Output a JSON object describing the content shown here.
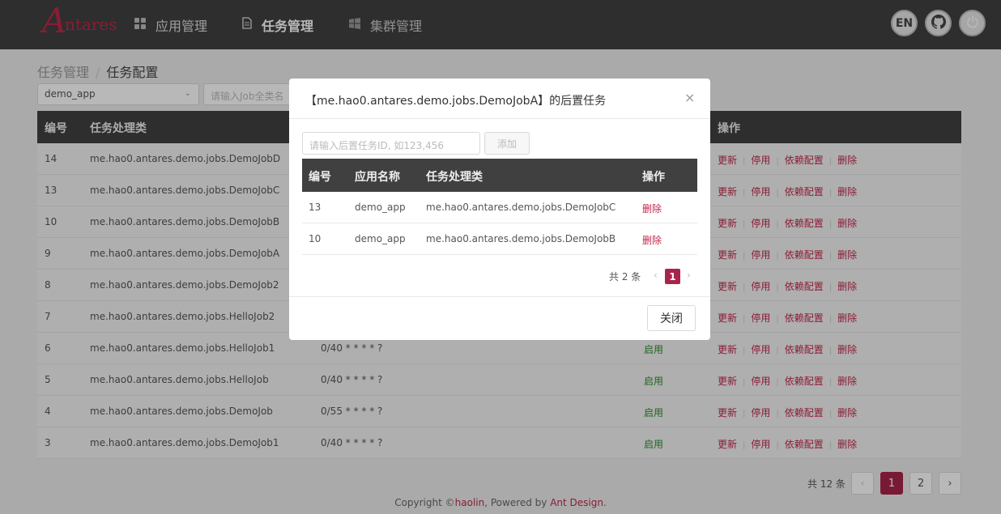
{
  "header": {
    "logo_text": "Antares",
    "nav": [
      {
        "label": "应用管理",
        "icon": "grid-icon"
      },
      {
        "label": "任务管理",
        "icon": "document-icon"
      },
      {
        "label": "集群管理",
        "icon": "windows-icon"
      }
    ],
    "lang_label": "EN",
    "github_icon": "github-icon",
    "power_icon": "power-icon"
  },
  "breadcrumb": {
    "parent": "任务管理",
    "separator": "/",
    "current": "任务配置"
  },
  "filters": {
    "app_select_value": "demo_app",
    "job_search_placeholder": "请输入Job全类名"
  },
  "table": {
    "columns": [
      "编号",
      "任务处理类",
      "操作"
    ],
    "rows": [
      {
        "id": "14",
        "cls": "me.hao0.antares.demo.jobs.DemoJobD",
        "cron": "",
        "status": ""
      },
      {
        "id": "13",
        "cls": "me.hao0.antares.demo.jobs.DemoJobC",
        "cron": "",
        "status": ""
      },
      {
        "id": "10",
        "cls": "me.hao0.antares.demo.jobs.DemoJobB",
        "cron": "",
        "status": ""
      },
      {
        "id": "9",
        "cls": "me.hao0.antares.demo.jobs.DemoJobA",
        "cron": "",
        "status": ""
      },
      {
        "id": "8",
        "cls": "me.hao0.antares.demo.jobs.DemoJob2",
        "cron": "",
        "status": ""
      },
      {
        "id": "7",
        "cls": "me.hao0.antares.demo.jobs.HelloJob2",
        "cron": "",
        "status": ""
      },
      {
        "id": "6",
        "cls": "me.hao0.antares.demo.jobs.HelloJob1",
        "cron": "0/40 * * * * ?",
        "status": "启用"
      },
      {
        "id": "5",
        "cls": "me.hao0.antares.demo.jobs.HelloJob",
        "cron": "0/40 * * * * ?",
        "status": "启用"
      },
      {
        "id": "4",
        "cls": "me.hao0.antares.demo.jobs.DemoJob",
        "cron": "0/55 * * * * ?",
        "status": "启用"
      },
      {
        "id": "3",
        "cls": "me.hao0.antares.demo.jobs.DemoJob1",
        "cron": "0/40 * * * * ?",
        "status": "启用"
      }
    ],
    "actions": [
      "更新",
      "停用",
      "依赖配置",
      "删除"
    ]
  },
  "pagination": {
    "total_text": "共 12 条",
    "pages": [
      "1",
      "2"
    ],
    "current": "1",
    "prev": "‹",
    "next": "›"
  },
  "footer": {
    "prefix": "Copyright  ©",
    "author": "haolin",
    "middle": ", Powered by ",
    "powered": "Ant Design",
    "suffix": "."
  },
  "modal": {
    "title": "【me.hao0.antares.demo.jobs.DemoJobA】的后置任务",
    "close_icon": "×",
    "input_placeholder": "请输入后置任务ID, 如123,456",
    "add_label": "添加",
    "columns": [
      "编号",
      "应用名称",
      "任务处理类",
      "操作"
    ],
    "rows": [
      {
        "id": "13",
        "app": "demo_app",
        "cls": "me.hao0.antares.demo.jobs.DemoJobC",
        "action": "删除"
      },
      {
        "id": "10",
        "app": "demo_app",
        "cls": "me.hao0.antares.demo.jobs.DemoJobB",
        "action": "删除"
      }
    ],
    "total_text": "共 2 条",
    "page": "1",
    "prev": "‹",
    "next": "›",
    "close_label": "关闭"
  },
  "colors": {
    "accent": "#a8244a",
    "header_bg": "#404040",
    "enabled": "#2e8b2e"
  }
}
